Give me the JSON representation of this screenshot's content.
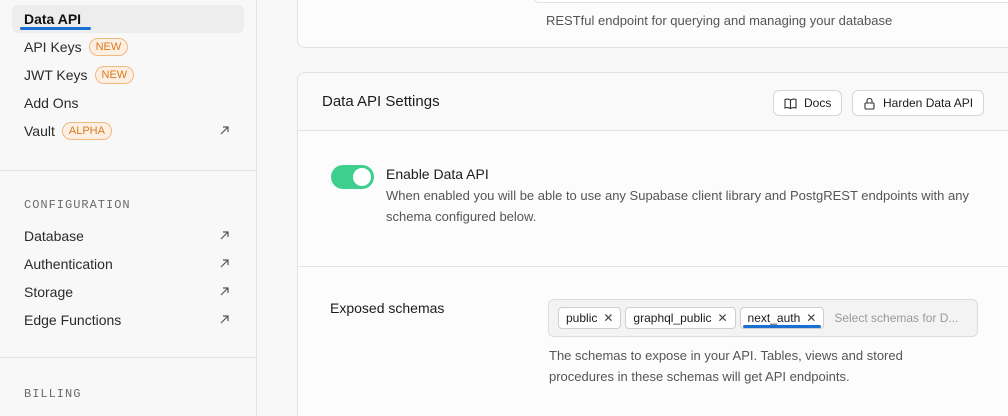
{
  "sidebar": {
    "items": [
      {
        "label": "Data API",
        "active": true
      },
      {
        "label": "API Keys",
        "badge": "NEW"
      },
      {
        "label": "JWT Keys",
        "badge": "NEW"
      },
      {
        "label": "Add Ons"
      },
      {
        "label": "Vault",
        "badge": "ALPHA",
        "external": true
      }
    ],
    "configuration": {
      "heading": "CONFIGURATION",
      "items": [
        {
          "label": "Database"
        },
        {
          "label": "Authentication"
        },
        {
          "label": "Storage"
        },
        {
          "label": "Edge Functions"
        }
      ]
    },
    "billing_heading": "BILLING"
  },
  "top_card": {
    "description": "RESTful endpoint for querying and managing your database"
  },
  "settings": {
    "title": "Data API Settings",
    "docs_label": "Docs",
    "harden_label": "Harden Data API",
    "enable": {
      "title": "Enable Data API",
      "description": "When enabled you will be able to use any Supabase client library and PostgREST endpoints with any schema configured below.",
      "enabled": true
    },
    "schemas": {
      "label": "Exposed schemas",
      "chips": [
        "public",
        "graphql_public",
        "next_auth"
      ],
      "placeholder": "Select schemas for D...",
      "help": "The schemas to expose in your API. Tables, views and stored procedures in these schemas will get API endpoints."
    }
  },
  "colors": {
    "toggle_on": "#3ecf8e",
    "badge_text": "#d97a1f",
    "highlight": "#1a6fd1"
  }
}
